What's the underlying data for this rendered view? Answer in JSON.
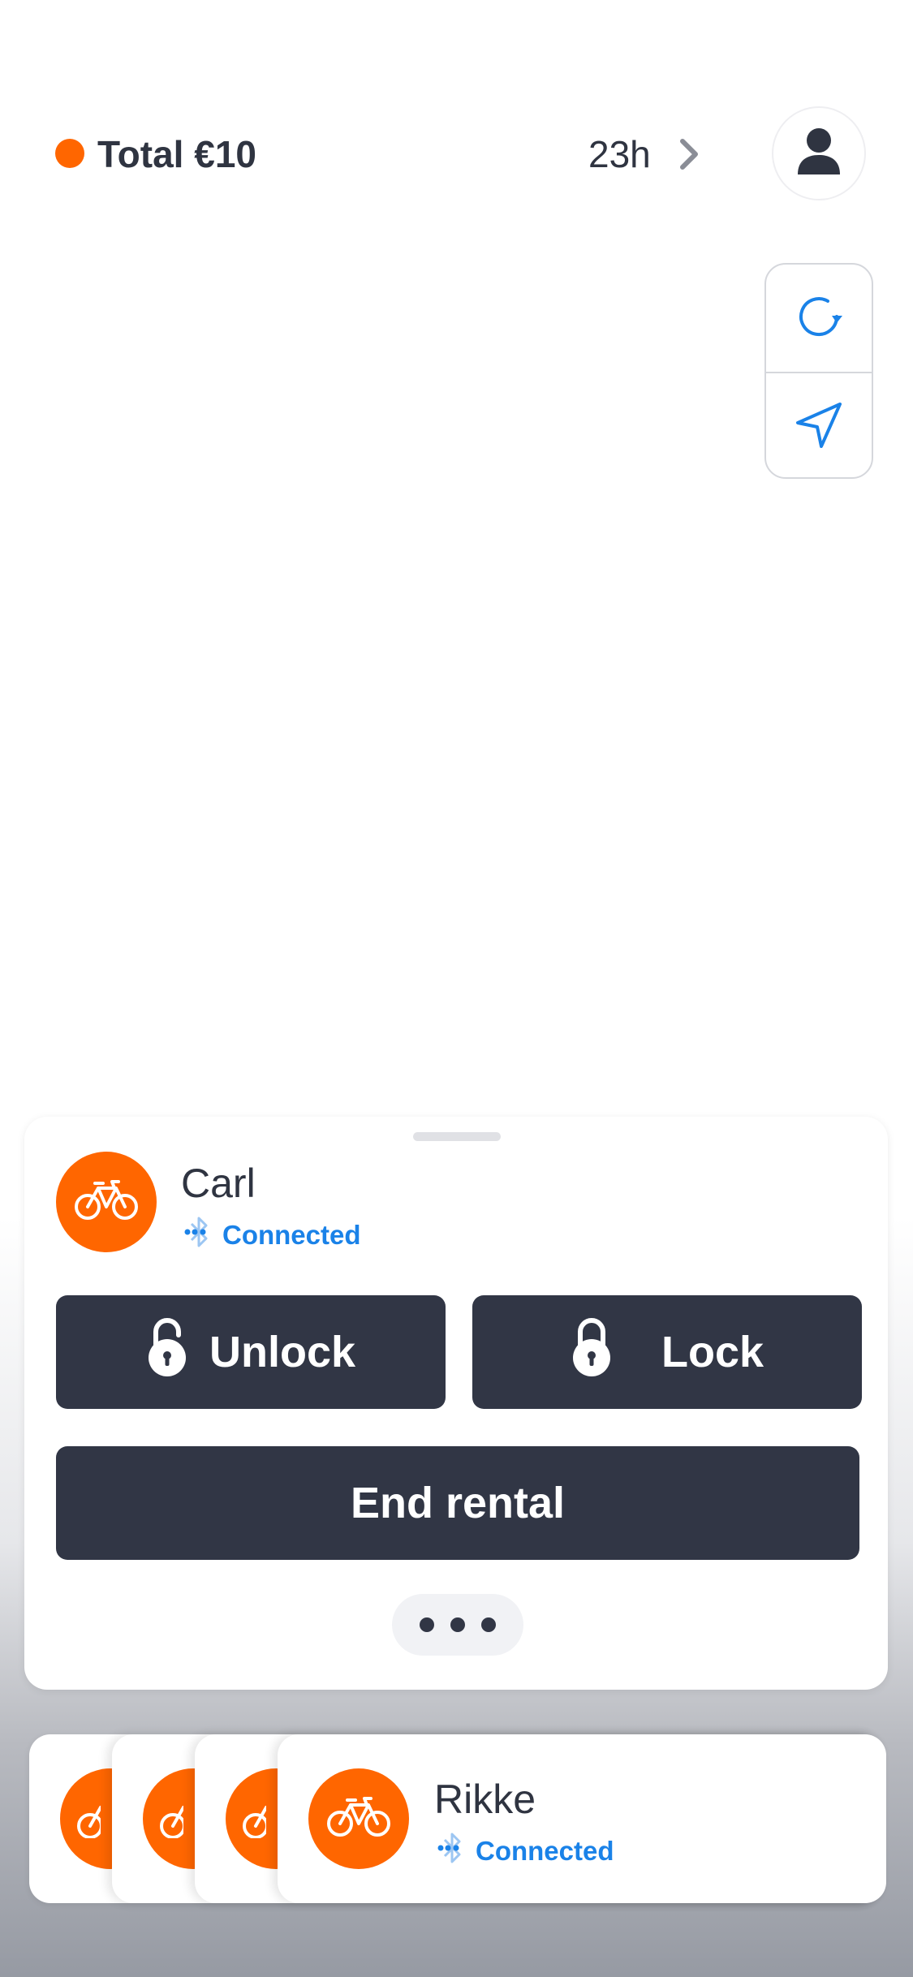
{
  "header": {
    "total_label": "Total €10",
    "time_label": "23h",
    "status_dot_color": "#ff6600",
    "icons": [
      "chevron-right-icon",
      "user-icon"
    ]
  },
  "map_controls": {
    "icons": [
      "refresh-icon",
      "navigation-arrow-icon"
    ],
    "accent_color": "#1a82e8"
  },
  "active_vehicle": {
    "name": "Carl",
    "status": "Connected",
    "status_icon": "bluetooth-icon",
    "avatar_icon": "bike-icon",
    "avatar_color": "#ff6600"
  },
  "actions": {
    "unlock_label": "Unlock",
    "lock_label": "Lock",
    "end_rental_label": "End rental",
    "more_icon": "more-dots-icon"
  },
  "vehicle_stack": {
    "front": {
      "name": "Rikke",
      "status": "Connected"
    },
    "stacked_card_count": 4
  },
  "colors": {
    "brand_orange": "#ff6600",
    "button_dark": "#313645",
    "link_blue": "#1a82e8"
  }
}
